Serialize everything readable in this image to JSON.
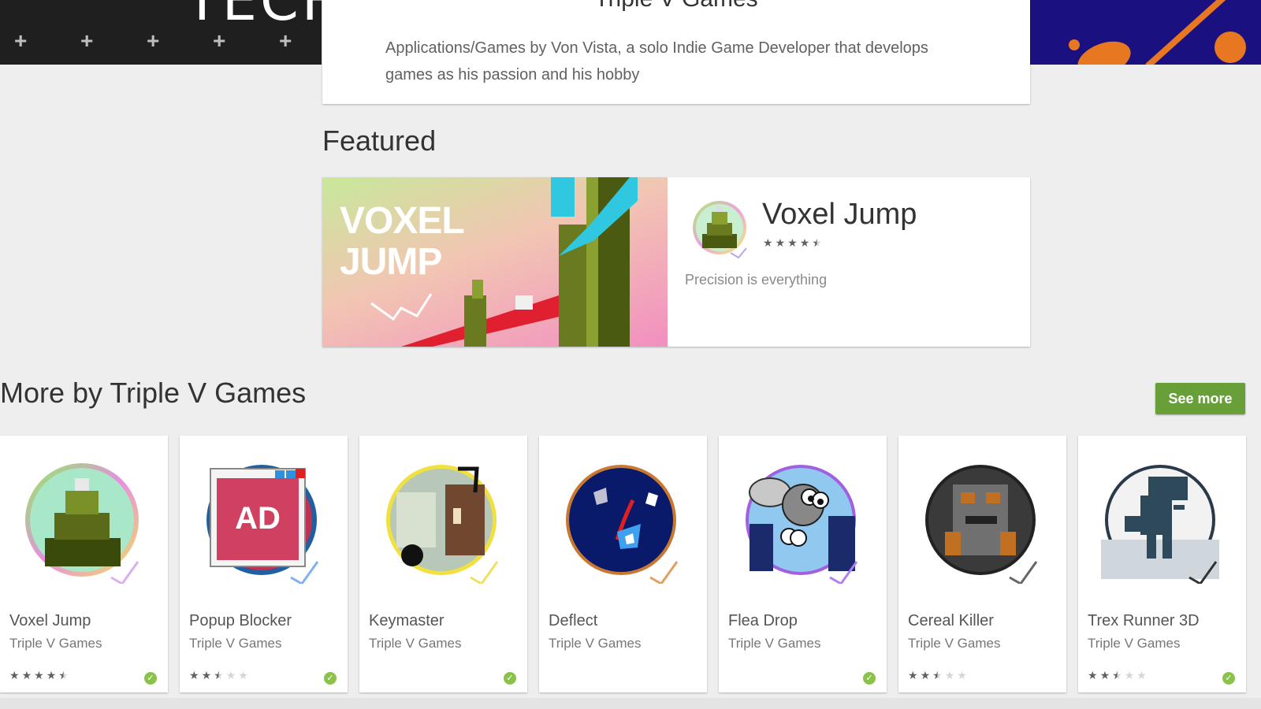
{
  "developer": {
    "title": "Triple V Games",
    "description": "Applications/Games by Von Vista, a solo Indie Game Developer that develops games as his passion and his hobby"
  },
  "banner": {
    "left_text": "TECH"
  },
  "featured": {
    "section_title": "Featured",
    "art_title_line1": "VOXEL",
    "art_title_line2": "JUMP",
    "app_name": "Voxel Jump",
    "rating": 4.5,
    "tagline": "Precision is everything"
  },
  "more": {
    "section_title": "More by Triple V Games",
    "see_more_label": "See more",
    "apps": [
      {
        "name": "Voxel Jump",
        "developer": "Triple V Games",
        "rating": 4.5,
        "verified": true,
        "icon": "voxel-jump-icon"
      },
      {
        "name": "Popup Blocker",
        "developer": "Triple V Games",
        "rating": 2.5,
        "verified": true,
        "icon": "popup-blocker-icon",
        "icon_text": "AD"
      },
      {
        "name": "Keymaster",
        "developer": "Triple V Games",
        "rating": null,
        "verified": true,
        "icon": "keymaster-icon"
      },
      {
        "name": "Deflect",
        "developer": "Triple V Games",
        "rating": null,
        "verified": false,
        "icon": "deflect-icon"
      },
      {
        "name": "Flea Drop",
        "developer": "Triple V Games",
        "rating": null,
        "verified": true,
        "icon": "flea-drop-icon"
      },
      {
        "name": "Cereal Killer",
        "developer": "Triple V Games",
        "rating": 2.5,
        "verified": false,
        "icon": "cereal-killer-icon"
      },
      {
        "name": "Trex Runner 3D",
        "developer": "Triple V Games",
        "rating": 2.5,
        "verified": true,
        "icon": "trex-runner-icon"
      }
    ]
  },
  "colors": {
    "accent_green": "#689f38",
    "verified_green": "#8bc34a",
    "background": "#eeeeee"
  }
}
